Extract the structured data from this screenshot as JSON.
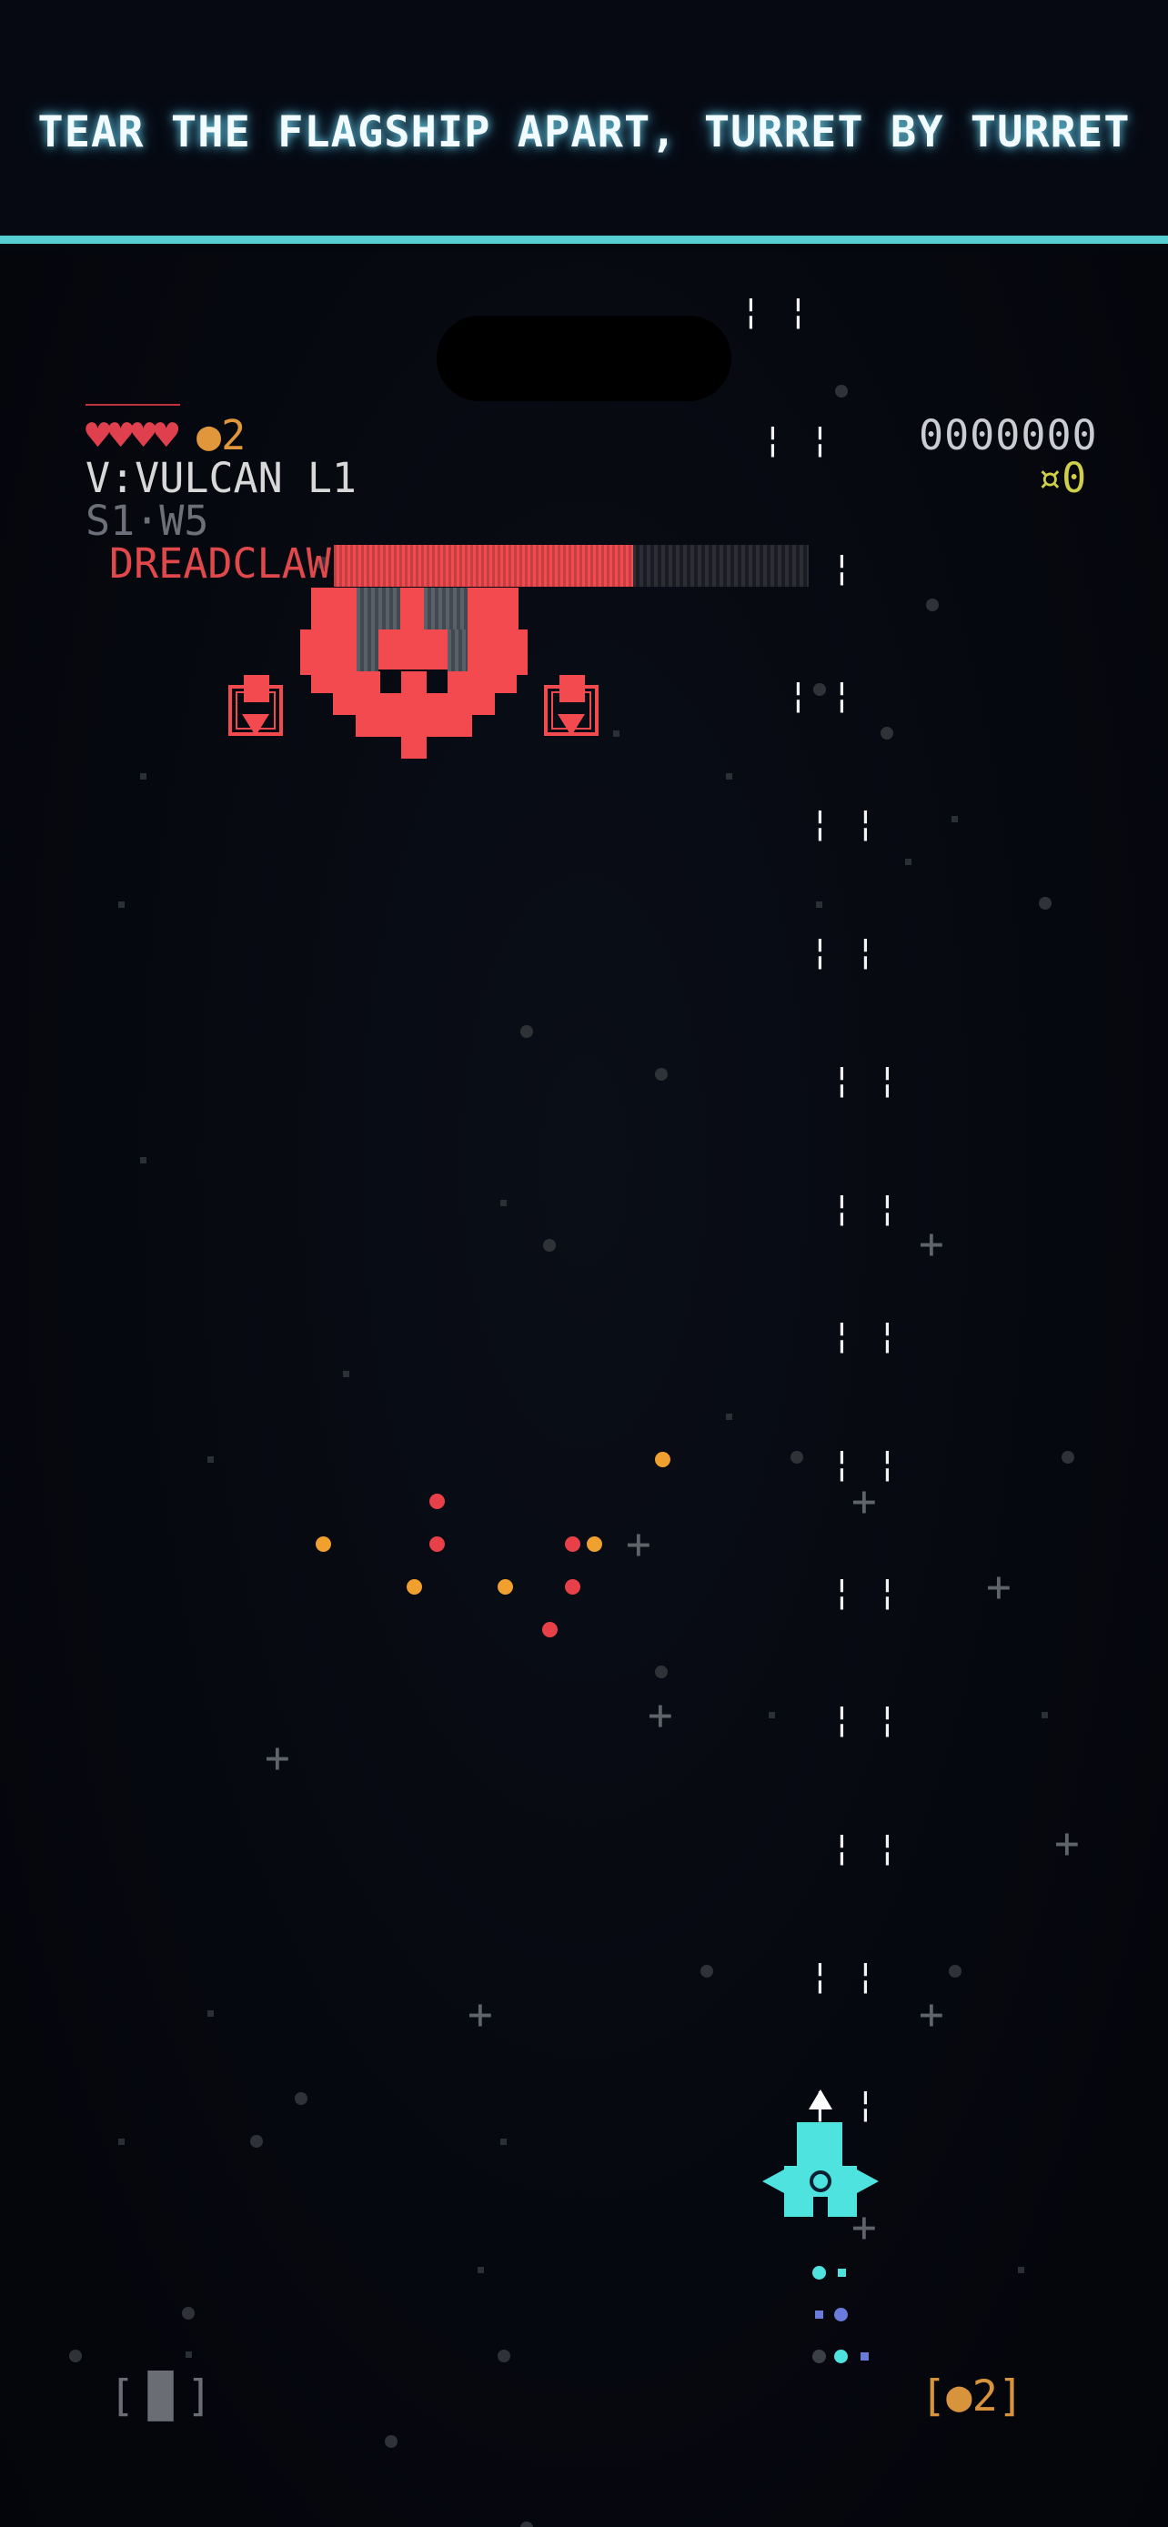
{
  "banner": {
    "text": "TEAR THE FLAGSHIP APART, TURRET BY TURRET"
  },
  "hud": {
    "hearts": "♥♥♥♥",
    "bombs": "●2",
    "weapon": "V:VULCAN L1",
    "stage": "S1·W5",
    "score": "0000000",
    "coins": "¤0"
  },
  "boss": {
    "name": "DREADCLAW",
    "health_fraction": 0.63
  },
  "controls": {
    "pause_label": "[▐▌]",
    "bomb_label": "[●2]"
  },
  "colors": {
    "accent": "#57cfd2",
    "boss": "#f24a4e",
    "player": "#4fe3e0",
    "hearts": "#e0404d",
    "coins": "#cfcf4a",
    "bomb": "#d8943c"
  }
}
